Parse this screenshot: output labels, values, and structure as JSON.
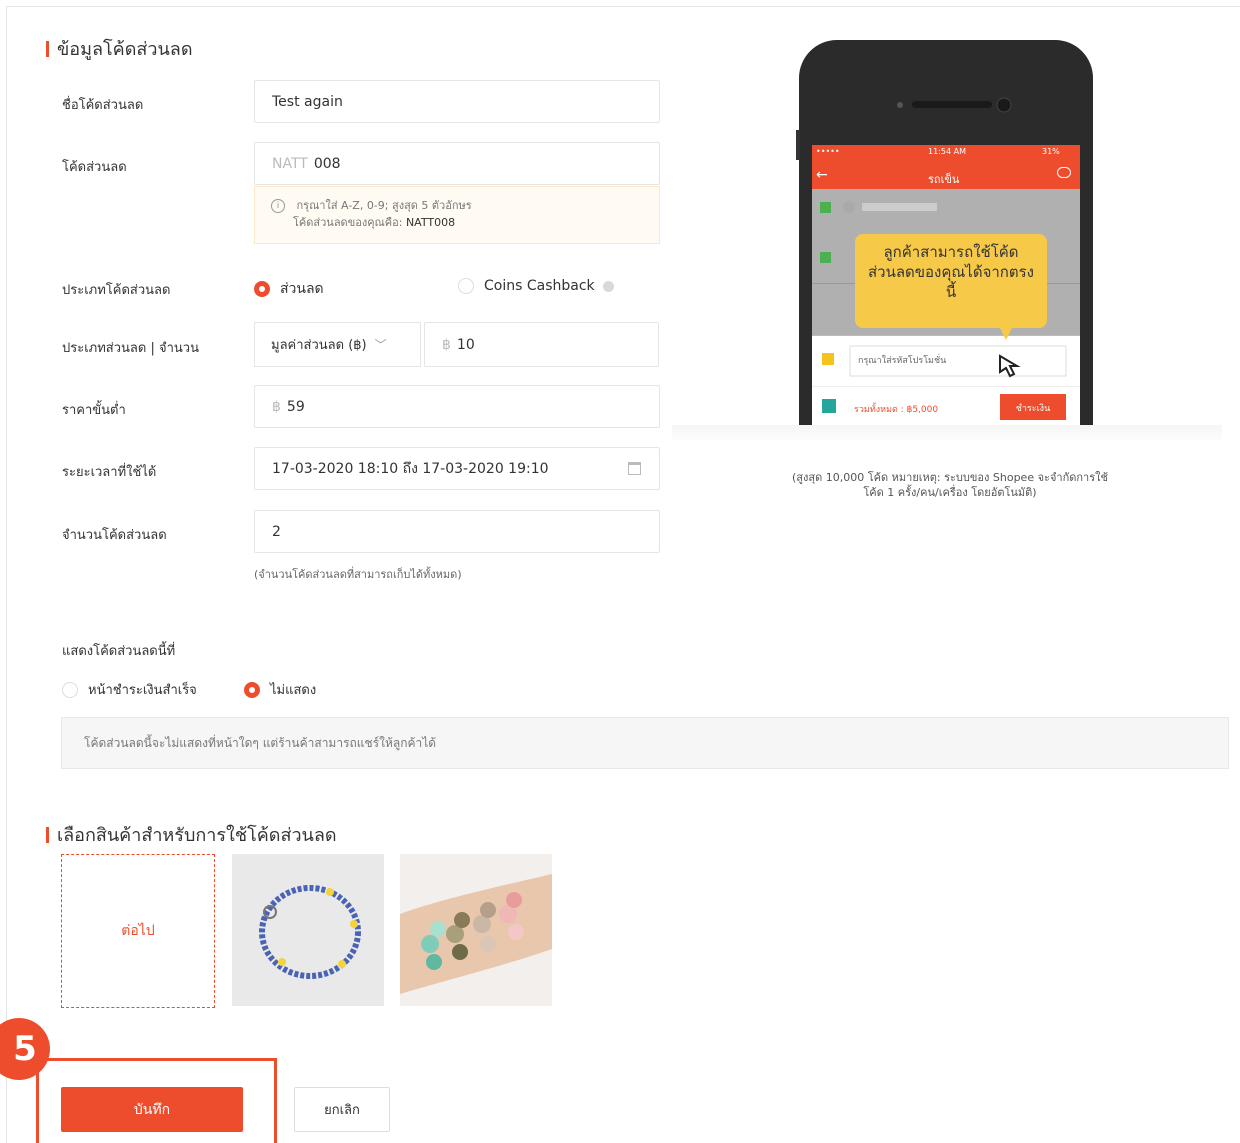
{
  "section1": {
    "title": "ข้อมูลโค้ดส่วนลด"
  },
  "fields": {
    "name": {
      "label": "ชื่อโค้ดส่วนลด",
      "value": "Test again"
    },
    "code": {
      "label": "โค้ดส่วนลด",
      "prefix": "NATT",
      "value": "008",
      "hint_line1": "กรุณาใส่ A-Z, 0-9; สูงสุด 5 ตัวอักษร",
      "hint_line2_label": "โค้ดส่วนลดของคุณคือ:",
      "hint_line2_value": "NATT008"
    },
    "voucher_type": {
      "label": "ประเภทโค้ดส่วนลด",
      "option1": "ส่วนลด",
      "option2": "Coins Cashback",
      "selected": "ส่วนลด"
    },
    "discount": {
      "label": "ประเภทส่วนลด | จำนวน",
      "select_value": "มูลค่าส่วนลด (฿)",
      "currency": "฿",
      "amount": "10"
    },
    "min_spend": {
      "label": "ราคาขั้นต่ำ",
      "currency": "฿",
      "value": "59"
    },
    "period": {
      "label": "ระยะเวลาที่ใช้ได้",
      "value": "17-03-2020 18:10 ถึง 17-03-2020 19:10"
    },
    "quantity": {
      "label": "จำนวนโค้ดส่วนลด",
      "value": "2",
      "note": "(จำนวนโค้ดส่วนลดที่สามารถเก็บได้ทั้งหมด)"
    }
  },
  "display": {
    "label": "แสดงโค้ดส่วนลดนี้ที่",
    "option1": "หน้าชำระเงินสำเร็จ",
    "option2": "ไม่แสดง",
    "selected": "ไม่แสดง",
    "info": "โค้ดส่วนลดนี้จะไม่แสดงที่หน้าใดๆ แต่ร้านค้าสามารถแชร์ให้ลูกค้าได้"
  },
  "section2": {
    "title": "เลือกสินค้าสำหรับการใช้โค้ดส่วนลด",
    "add_label": "ต่อไป"
  },
  "phone": {
    "time": "11:54 AM",
    "signal": "•••••",
    "battery": "31%",
    "header": "รถเข็น",
    "tooltip": "ลูกค้าสามารถใช้โค้ดส่วนลดของคุณได้จากตรงนี้",
    "promo_placeholder": "กรุณาใส่รหัสโปรโมชั่น",
    "total": "รวมทั้งหมด : ฿5,000",
    "pay": "ชำระเงิน"
  },
  "side_note": "(สูงสุด 10,000 โค้ด หมายเหตุ: ระบบของ Shopee จะจำกัดการใช้โค้ด 1 ครั้ง/คน/เครื่อง โดยอัตโนมัติ)",
  "buttons": {
    "save": "บันทึก",
    "cancel": "ยกเลิก"
  },
  "step": "5",
  "colors": {
    "accent": "#ee4d2d"
  }
}
